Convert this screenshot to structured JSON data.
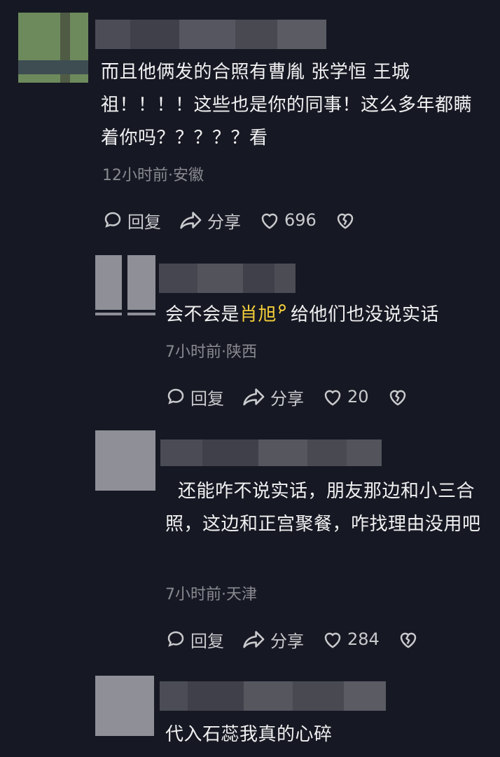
{
  "comments": [
    {
      "text": "而且他俩发的合照有曹胤 张学恒 王城祖！！！！这些也是你的同事！这么多年都瞒着你吗？？？？？看",
      "meta": "12小时前·安徽",
      "reply": "回复",
      "share": "分享",
      "likes": "696"
    },
    {
      "text_before": "会不会是",
      "highlight": "肖旭",
      "text_after": "给他们也没说实话",
      "meta": "7小时前·陕西",
      "reply": "回复",
      "share": "分享",
      "likes": "20"
    },
    {
      "text": "还能咋不说实话，朋友那边和小三合照，这边和正宫聚餐，咋找理由没用吧",
      "meta": "7小时前·天津",
      "reply": "回复",
      "share": "分享",
      "likes": "284"
    },
    {
      "text": "代入石蕊我真的心碎"
    }
  ],
  "colors": {
    "background": "#161823",
    "highlight": "#f4cf3a",
    "meta": "#8a8b91"
  },
  "icons": [
    "comment-icon",
    "share-icon",
    "heart-icon",
    "broken-heart-icon",
    "search-icon"
  ]
}
